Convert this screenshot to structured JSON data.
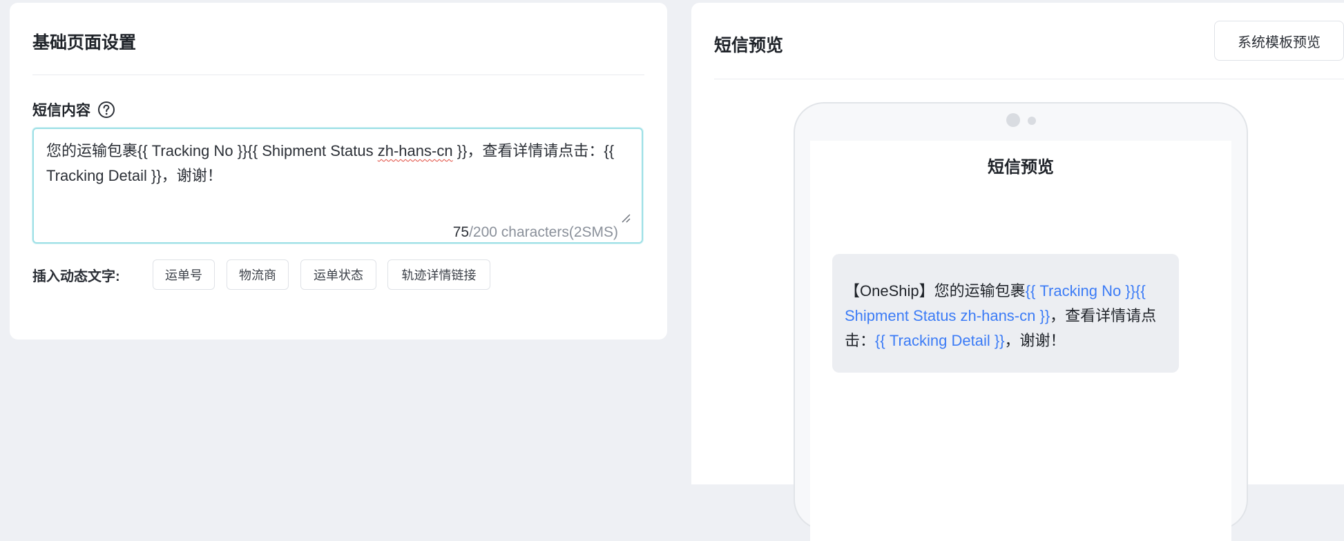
{
  "settings_panel": {
    "title": "基础页面设置",
    "sms_content_label": "短信内容",
    "textarea": {
      "value_part1": "您的运输包裹{{ Tracking No }}{{ Shipment Status ",
      "value_squiggle": "zh-hans-cn",
      "value_part2": " }}，查看详情请点击：{{ Tracking Detail }}，谢谢！"
    },
    "char_count": {
      "current": "75",
      "rest": "/200 characters(2SMS)"
    },
    "insert_label": "插入动态文字:",
    "insert_chips": [
      "运单号",
      "物流商",
      "运单状态",
      "轨迹详情链接"
    ]
  },
  "preview_panel": {
    "title": "短信预览",
    "template_button": "系统模板预览",
    "phone": {
      "screen_title": "短信预览",
      "message": {
        "prefix": "【OneShip】您的运输包裹",
        "var1": "{{ Tracking No }}{{ Shipment Status zh-hans-cn }}",
        "mid": "，查看详情请点击：",
        "var2": "{{ Tracking Detail }}",
        "suffix": "，谢谢！"
      }
    }
  },
  "colors": {
    "accent_border": "#9ee0e6",
    "variable_text": "#3b7bf6",
    "background": "#eef0f4"
  },
  "icons": {
    "help": "question-circle-icon",
    "resize": "resize-grip-icon"
  }
}
